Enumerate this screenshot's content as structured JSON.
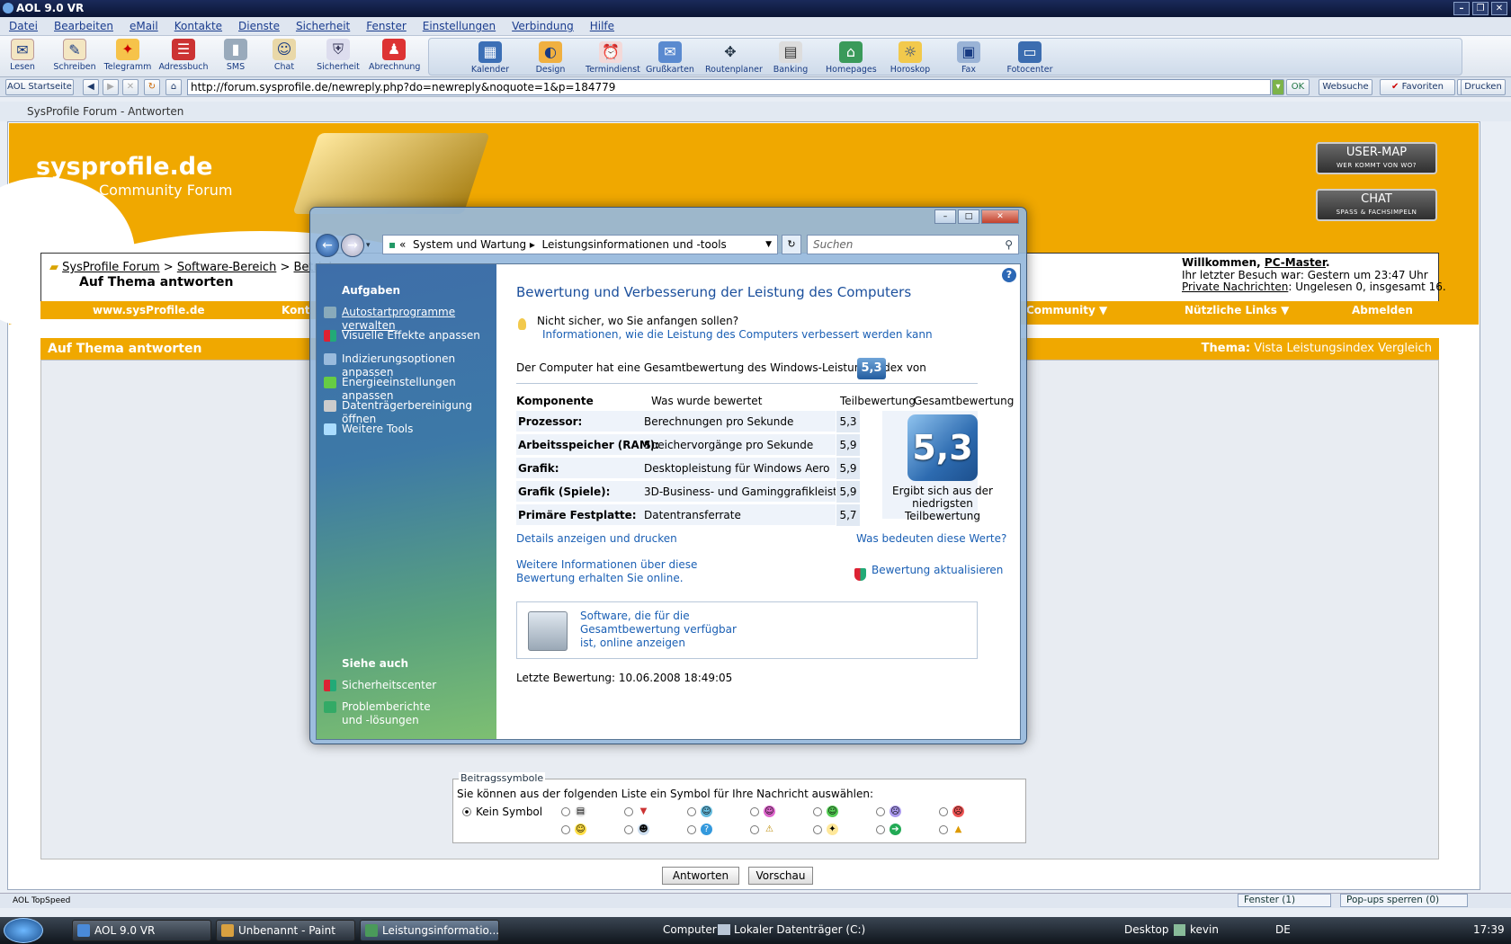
{
  "aol": {
    "window_title": "AOL 9.0 VR",
    "menu": [
      "Datei",
      "Bearbeiten",
      "eMail",
      "Kontakte",
      "Dienste",
      "Sicherheit",
      "Fenster",
      "Einstellungen",
      "Verbindung",
      "Hilfe"
    ],
    "toolbar_left": [
      {
        "label": "Lesen",
        "icon": "mail-icon"
      },
      {
        "label": "Schreiben",
        "icon": "write-icon"
      },
      {
        "label": "Telegramm",
        "icon": "aim-icon"
      },
      {
        "label": "Adressbuch",
        "icon": "addressbook-icon"
      },
      {
        "label": "SMS",
        "icon": "phone-icon"
      },
      {
        "label": "Chat",
        "icon": "chat-icon"
      },
      {
        "label": "Sicherheit",
        "icon": "shield-icon"
      },
      {
        "label": "Abrechnung",
        "icon": "billing-icon"
      }
    ],
    "toolbar_right": [
      {
        "label": "Kalender",
        "icon": "calendar-icon"
      },
      {
        "label": "Design",
        "icon": "palette-icon"
      },
      {
        "label": "Termindienst",
        "icon": "alarm-icon"
      },
      {
        "label": "Grußkarten",
        "icon": "card-icon"
      },
      {
        "label": "Routenplaner",
        "icon": "compass-icon"
      },
      {
        "label": "Banking",
        "icon": "bank-icon"
      },
      {
        "label": "Homepages",
        "icon": "house-icon"
      },
      {
        "label": "Horoskop",
        "icon": "horoscope-icon"
      },
      {
        "label": "Fax",
        "icon": "fax-icon"
      },
      {
        "label": "Fotocenter",
        "icon": "photo-icon"
      }
    ],
    "start_button": "AOL Startseite",
    "url": "http://forum.sysprofile.de/newreply.php?do=newreply&noquote=1&p=184779",
    "ok": "OK",
    "websuche": "Websuche",
    "favoriten": "Favoriten",
    "drucken": "Drucken",
    "frame_title": "SysProfile Forum - Antworten",
    "status_left": "AOL TopSpeed",
    "fenster": "Fenster (1)",
    "popups": "Pop-ups sperren (0)"
  },
  "forum": {
    "logo": "sysprofile.de",
    "logo_sub": "Community Forum",
    "usermap": "USER-MAP",
    "usermap_sub": "WER KOMMT VON WO?",
    "chat": "CHAT",
    "chat_sub": "SPASS & FACHSIMPELN",
    "crumbs": [
      "SysProfile Forum",
      "Software-Bereich",
      "Betrieb"
    ],
    "crumb_current": "Auf Thema antworten",
    "welcome_prefix": "Willkommen, ",
    "welcome_user": "PC-Master",
    "last_visit": "Ihr letzter Besuch war: Gestern um 23:47 Uhr",
    "pm_link": "Private Nachrichten",
    "pm_rest": ": Ungelesen 0, insgesamt 16.",
    "nav": [
      "www.sysProfile.de",
      "Kont",
      "Community ▼",
      "Nützliche Links ▼",
      "Abmelden"
    ],
    "section_title": "Auf Thema antworten",
    "thema_label": "Thema:",
    "thema_value": "Vista Leistungsindex Vergleich",
    "beitrag_legend": "Beitragssymbole",
    "beitrag_desc": "Sie können aus der folgenden Liste ein Symbol für Ihre Nachricht auswählen:",
    "kein_symbol": "Kein Symbol",
    "btn_antworten": "Antworten",
    "btn_vorschau": "Vorschau"
  },
  "dialog": {
    "crumb_root": "«",
    "crumb_1": "System und Wartung",
    "crumb_2": "Leistungsinformationen und -tools",
    "search_placeholder": "Suchen",
    "tasks_heading": "Aufgaben",
    "tasks": [
      "Autostartprogramme verwalten",
      "Visuelle Effekte anpassen",
      "Indizierungsoptionen anpassen",
      "Energieeinstellungen anpassen",
      "Datenträgerbereinigung öffnen",
      "Weitere Tools"
    ],
    "see_also_heading": "Siehe auch",
    "see_also": [
      "Sicherheitscenter",
      "Problemberichte und -lösungen"
    ],
    "title": "Bewertung und Verbesserung der Leistung des Computers",
    "hint": "Nicht sicher, wo Sie anfangen sollen?",
    "hint_link": "Informationen, wie die Leistung des Computers verbessert werden kann",
    "gesamt_text": "Der Computer hat eine Gesamtbewertung des Windows-Leistungsindex von",
    "score": "5,3",
    "headers": [
      "Komponente",
      "Was wurde bewertet",
      "Teilbewertung",
      "Gesamtbewertung"
    ],
    "rows": [
      {
        "komponente": "Prozessor:",
        "was": "Berechnungen pro Sekunde",
        "wert": "5,3"
      },
      {
        "komponente": "Arbeitsspeicher (RAM):",
        "was": "Speichervorgänge pro Sekunde",
        "wert": "5,9"
      },
      {
        "komponente": "Grafik:",
        "was": "Desktopleistung für Windows Aero",
        "wert": "5,9"
      },
      {
        "komponente": "Grafik (Spiele):",
        "was": "3D-Business- und Gaminggrafikleistung",
        "wert": "5,9"
      },
      {
        "komponente": "Primäre Festplatte:",
        "was": "Datentransferrate",
        "wert": "5,7"
      }
    ],
    "big_caption": "Ergibt sich aus der niedrigsten Teilbewertung",
    "details_link": "Details anzeigen und drucken",
    "bedeuten_link": "Was bedeuten diese Werte?",
    "weitere_link": "Weitere Informationen über diese Bewertung erhalten Sie online.",
    "aktualisieren_link": "Bewertung aktualisieren",
    "software_link": "Software, die für die Gesamtbewertung verfügbar ist, online anzeigen",
    "letzte": "Letzte Bewertung: 10.06.2008 18:49:05"
  },
  "taskbar": {
    "items": [
      "AOL 9.0 VR",
      "Unbenannt - Paint",
      "Leistungsinformatio..."
    ],
    "computer": "Computer",
    "drive": "Lokaler Datenträger (C:)",
    "desktop": "Desktop",
    "user": "kevin",
    "lang": "DE",
    "clock": "17:39"
  }
}
